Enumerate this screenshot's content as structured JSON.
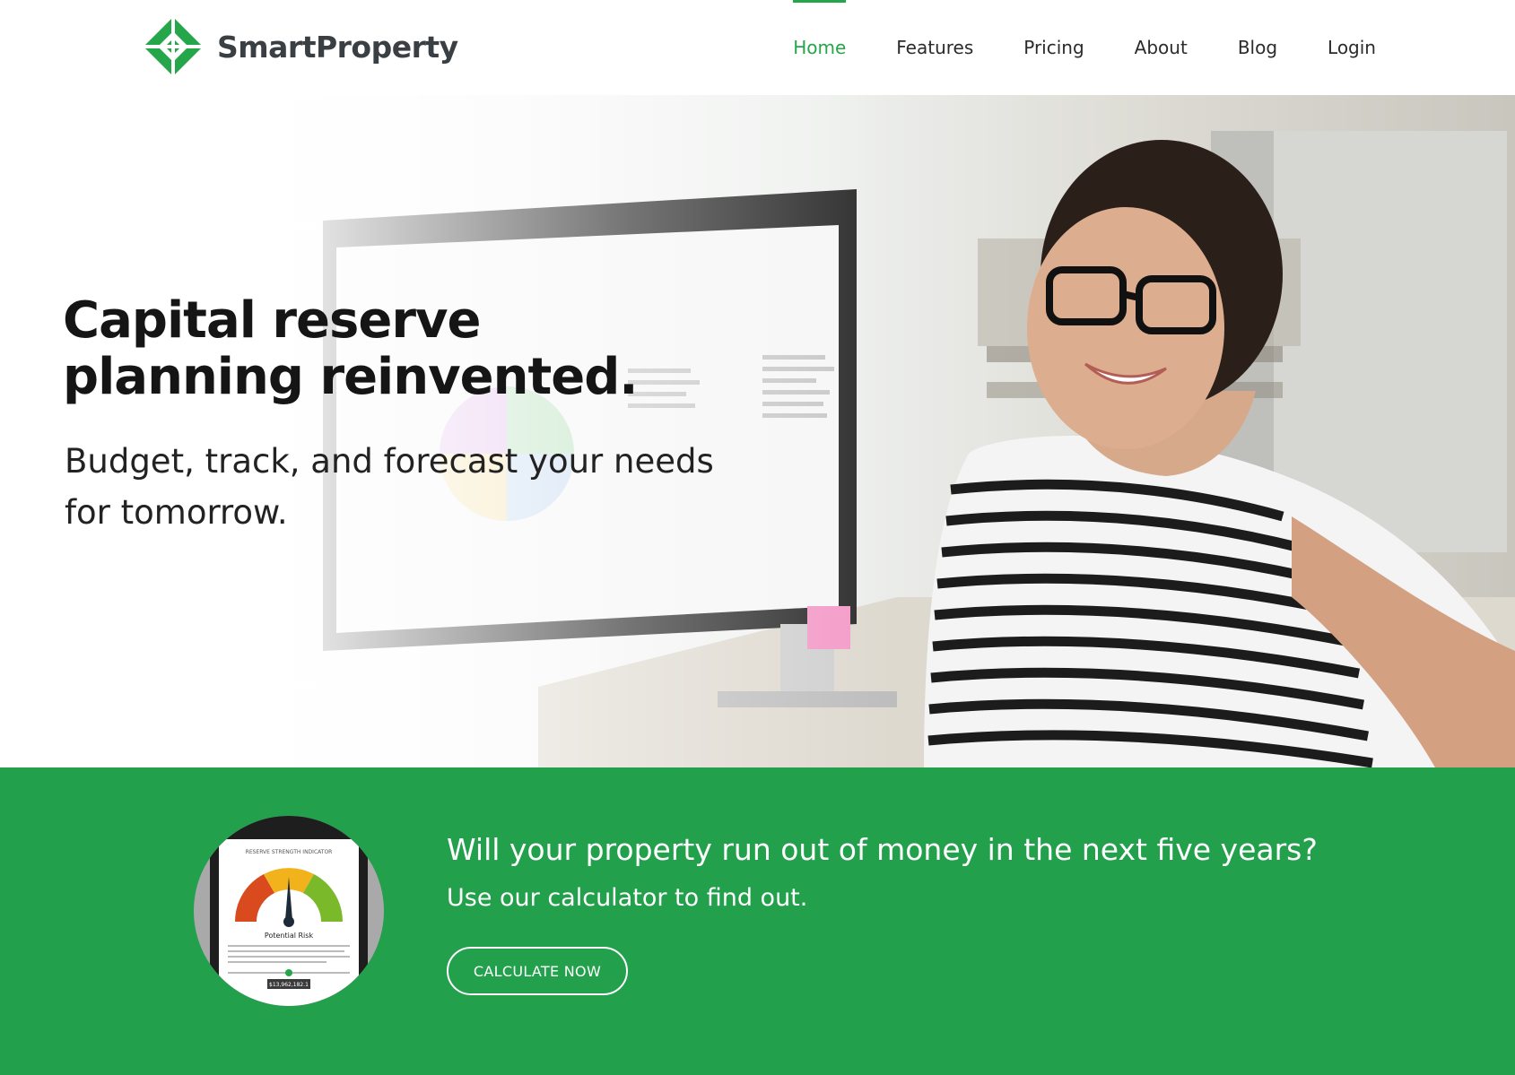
{
  "header": {
    "brand": "SmartProperty",
    "nav": [
      {
        "label": "Home",
        "active": true
      },
      {
        "label": "Features",
        "active": false
      },
      {
        "label": "Pricing",
        "active": false
      },
      {
        "label": "About",
        "active": false
      },
      {
        "label": "Blog",
        "active": false
      },
      {
        "label": "Login",
        "active": false
      }
    ]
  },
  "hero": {
    "title_line1": "Capital reserve",
    "title_line2": "planning reinvented.",
    "subtitle_line1": "Budget, track, and forecast your needs",
    "subtitle_line2": "for tomorrow.",
    "image": "woman-at-desk-with-monitor-photo"
  },
  "cta": {
    "question": "Will your property run out of money in the next five years?",
    "subtitle": "Use our calculator to find out.",
    "button_label": "CALCULATE NOW",
    "tablet": {
      "heading": "RESERVE STRENGTH INDICATOR",
      "gauge_label": "Potential Risk",
      "amount": "$13,962,182.1"
    }
  },
  "colors": {
    "brand_green": "#22a04b",
    "nav_active": "#26a64a",
    "text_dark": "#151515"
  }
}
